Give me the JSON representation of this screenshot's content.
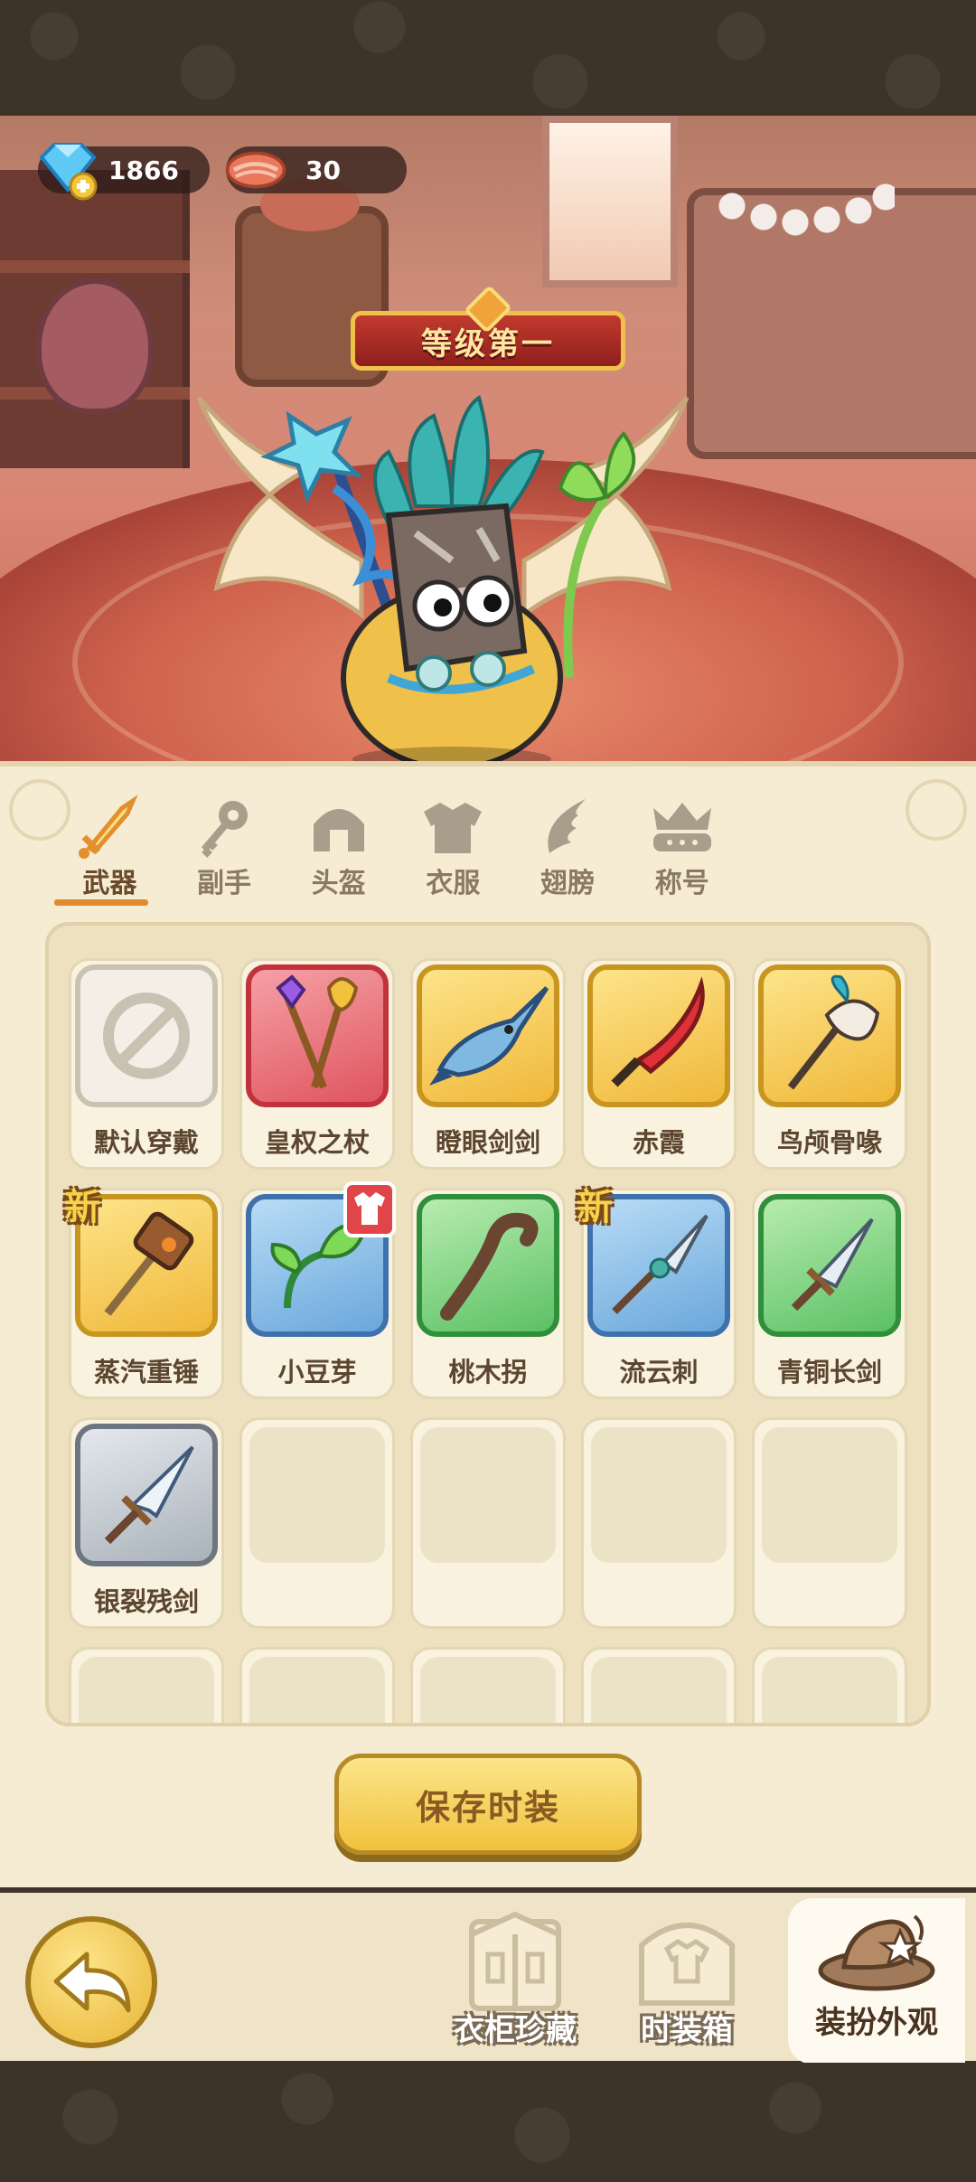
{
  "currency": {
    "gems": "1866",
    "meat": "30"
  },
  "rank_banner": "等级第一",
  "tabs": [
    {
      "label": "武器",
      "icon": "sword-icon",
      "active": true
    },
    {
      "label": "副手",
      "icon": "key-icon",
      "active": false
    },
    {
      "label": "头盔",
      "icon": "helmet-icon",
      "active": false
    },
    {
      "label": "衣服",
      "icon": "armor-icon",
      "active": false
    },
    {
      "label": "翅膀",
      "icon": "wing-icon",
      "active": false
    },
    {
      "label": "称号",
      "icon": "crown-icon",
      "active": false
    }
  ],
  "items": [
    {
      "name": "默认穿戴",
      "rarity": "gray",
      "icon": "none-icon"
    },
    {
      "name": "皇权之杖",
      "rarity": "red",
      "icon": "scepter-icon"
    },
    {
      "name": "瞪眼剑剑",
      "rarity": "gold",
      "icon": "swordfish-icon"
    },
    {
      "name": "赤霞",
      "rarity": "gold",
      "icon": "red-blade-icon"
    },
    {
      "name": "鸟颅骨喙",
      "rarity": "gold",
      "icon": "bird-skull-staff-icon"
    },
    {
      "name": "蒸汽重锤",
      "rarity": "gold",
      "icon": "hammer-icon",
      "badge": "新"
    },
    {
      "name": "小豆芽",
      "rarity": "blue",
      "icon": "sprout-icon",
      "shirt_badge": true
    },
    {
      "name": "桃木拐",
      "rarity": "green",
      "icon": "cane-icon"
    },
    {
      "name": "流云刺",
      "rarity": "blue",
      "icon": "spear-icon",
      "badge": "新"
    },
    {
      "name": "青铜长剑",
      "rarity": "green",
      "icon": "bronze-sword-icon"
    },
    {
      "name": "银裂残剑",
      "rarity": "silver",
      "icon": "silver-sword-icon"
    }
  ],
  "save_button": "保存时装",
  "bottom_nav": {
    "wardrobe": "衣柜珍藏",
    "fashion_box": "时装箱",
    "dress_up": "装扮外观"
  },
  "colors": {
    "accent": "#e28a2e",
    "panel": "#f5ecd3",
    "button": "#f1c23d"
  }
}
